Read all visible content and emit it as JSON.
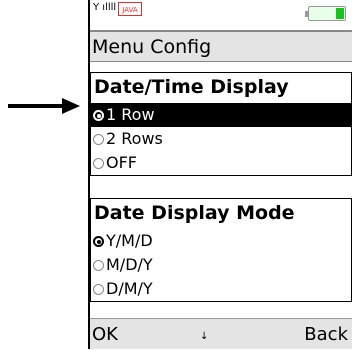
{
  "status": {
    "signal": "Y ıllll",
    "java_badge": "JAVA"
  },
  "title": "Menu Config",
  "sections": [
    {
      "heading": "Date/Time Display",
      "options": [
        "1 Row",
        "2 Rows",
        "OFF"
      ]
    },
    {
      "heading": "Date Display Mode",
      "options": [
        "Y/M/D",
        "M/D/Y",
        "D/M/Y"
      ]
    }
  ],
  "softkeys": {
    "left": "OK",
    "middle": "↓",
    "right": "Back"
  },
  "colors": {
    "battery": "#19c31e",
    "highlight": "#000000",
    "bar": "#e4e4e4"
  }
}
